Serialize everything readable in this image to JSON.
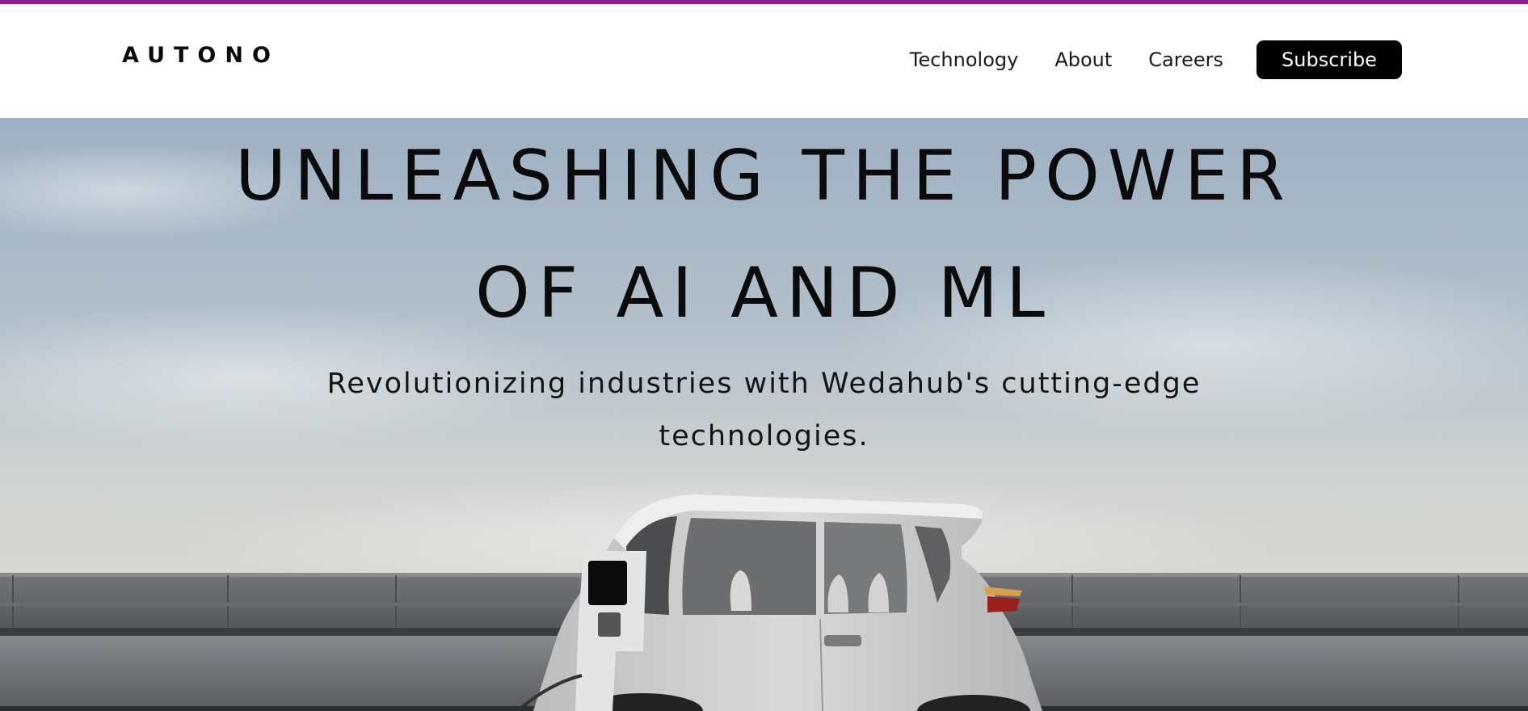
{
  "brand": {
    "logo_text": "AUTONO"
  },
  "nav": {
    "items": [
      {
        "label": "Technology"
      },
      {
        "label": "About"
      },
      {
        "label": "Careers"
      }
    ],
    "subscribe_label": "Subscribe"
  },
  "hero": {
    "headline_line1": "UNLEASHING THE POWER",
    "headline_line2": "OF AI AND ML",
    "subtitle": "Revolutionizing industries with Wedahub's cutting-edge technologies."
  },
  "colors": {
    "accent_bar": "#8e1e8e",
    "button_bg": "#000000",
    "button_text": "#ffffff"
  },
  "icons": {
    "hero_image": "electric-vehicle-charging-image"
  }
}
